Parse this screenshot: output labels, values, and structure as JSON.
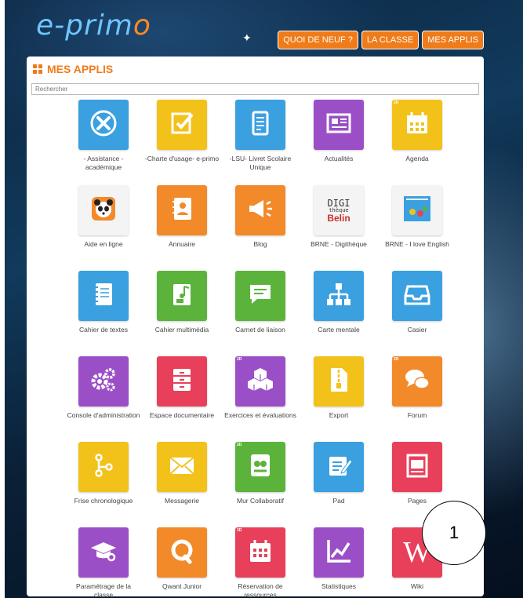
{
  "header": {
    "logo_left": "e-prim",
    "logo_o": "o",
    "nav": [
      "QUOI DE NEUF ?",
      "LA CLASSE",
      "MES APPLIS"
    ]
  },
  "panel": {
    "title": "MES APPLIS",
    "search_placeholder": "Rechercher"
  },
  "apps": [
    {
      "label": "- Assistance - académique",
      "color": "#3aa0e0",
      "icon": "tools-icon"
    },
    {
      "label": "-Charte d'usage- e-primo",
      "color": "#f2c21a",
      "icon": "charter-icon"
    },
    {
      "label": "-LSU- Livret Scolaire Unique",
      "color": "#3aa0e0",
      "icon": "booklet-icon"
    },
    {
      "label": "Actualités",
      "color": "#9b4fc7",
      "icon": "newspaper-icon"
    },
    {
      "label": "Agenda",
      "color": "#f2c21a",
      "icon": "calendar-icon",
      "tag": "2D"
    },
    {
      "label": "Aide en ligne",
      "color": "#f4f4f4",
      "icon": "panda-icon"
    },
    {
      "label": "Annuaire",
      "color": "#f28a2a",
      "icon": "contact-book-icon"
    },
    {
      "label": "Blog",
      "color": "#f28a2a",
      "icon": "megaphone-icon"
    },
    {
      "label": "BRNE - Digithèque",
      "color": "#f4f4f4",
      "icon": "digitheque-logo-icon",
      "logo_lines": [
        "DIGI",
        "thèque",
        "Belin"
      ]
    },
    {
      "label": "BRNE - I love English",
      "color": "#f4f4f4",
      "icon": "i-love-english-icon"
    },
    {
      "label": "Cahier de textes",
      "color": "#3aa0e0",
      "icon": "notebook-icon"
    },
    {
      "label": "Cahier multimédia",
      "color": "#5cb33c",
      "icon": "multimedia-notebook-icon"
    },
    {
      "label": "Carnet de liaison",
      "color": "#5cb33c",
      "icon": "chat-bubble-icon"
    },
    {
      "label": "Carte mentale",
      "color": "#3aa0e0",
      "icon": "mindmap-icon"
    },
    {
      "label": "Casier",
      "color": "#3aa0e0",
      "icon": "inbox-tray-icon"
    },
    {
      "label": "Console d'administration",
      "color": "#9b4fc7",
      "icon": "gears-icon"
    },
    {
      "label": "Espace documentaire",
      "color": "#e8405a",
      "icon": "drawers-icon"
    },
    {
      "label": "Exercices et évaluations",
      "color": "#9b4fc7",
      "icon": "cubes-icon",
      "tag": "2D"
    },
    {
      "label": "Export",
      "color": "#f2c21a",
      "icon": "zip-file-icon"
    },
    {
      "label": "Forum",
      "color": "#f28a2a",
      "icon": "discussion-icon",
      "tag": "2D"
    },
    {
      "label": "Frise chronologique",
      "color": "#f2c21a",
      "icon": "timeline-icon"
    },
    {
      "label": "Messagerie",
      "color": "#f2c21a",
      "icon": "envelope-icon"
    },
    {
      "label": "Mur Collaboratif",
      "color": "#5cb33c",
      "icon": "wall-icon",
      "tag": "2D"
    },
    {
      "label": "Pad",
      "color": "#3aa0e0",
      "icon": "pad-icon"
    },
    {
      "label": "Pages",
      "color": "#e8405a",
      "icon": "page-icon"
    },
    {
      "label": "Paramétrage de la classe",
      "color": "#9b4fc7",
      "icon": "graduation-cap-icon"
    },
    {
      "label": "Qwant Junior",
      "color": "#f28a2a",
      "icon": "qwant-icon"
    },
    {
      "label": "Réservation de ressources",
      "color": "#e8405a",
      "icon": "booking-calendar-icon",
      "tag": "2D"
    },
    {
      "label": "Statistiques",
      "color": "#9b4fc7",
      "icon": "chart-line-icon"
    },
    {
      "label": "Wiki",
      "color": "#e8405a",
      "icon": "wiki-icon",
      "glyph": "W"
    }
  ],
  "callout": {
    "number": "1"
  }
}
